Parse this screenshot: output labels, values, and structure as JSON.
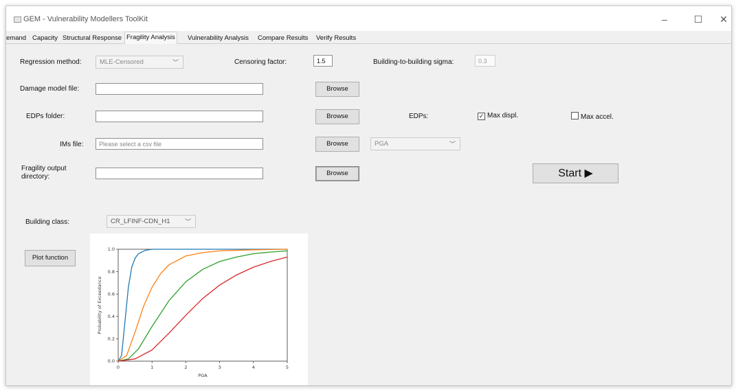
{
  "window": {
    "title": "GEM - Vulnerability Modellers ToolKit",
    "controls": {
      "minimize": "–",
      "maximize": "☐",
      "close": "✕"
    }
  },
  "tabs": [
    {
      "label": "emand",
      "active": false
    },
    {
      "label": "Capacity",
      "active": false
    },
    {
      "label": "Structural Response",
      "active": false
    },
    {
      "label": "Fragility Analysis",
      "active": true
    },
    {
      "label": "Vulnerability Analysis",
      "active": false
    },
    {
      "label": "Compare Results",
      "active": false
    },
    {
      "label": "Verify Results",
      "active": false
    }
  ],
  "form": {
    "regression_label": "Regression method:",
    "regression_value": "MLE-Censored",
    "censoring_label": "Censoring factor:",
    "censoring_value": "1.5",
    "sigma_label": "Building-to-building sigma:",
    "sigma_value": "0.3",
    "damage_model_label": "Damage model file:",
    "damage_model_value": "",
    "edps_folder_label": "EDPs folder:",
    "edps_folder_value": "",
    "edps_label": "EDPs:",
    "max_displ_label": "Max displ.",
    "max_displ_checked": true,
    "max_accel_label": "Max accel.",
    "max_accel_checked": false,
    "ims_label": "IMs file:",
    "ims_placeholder": "Please select a csv file",
    "im_type_value": "PGA",
    "output_label_line1": "Fragility output",
    "output_label_line2": "directory:",
    "output_value": "",
    "browse_label": "Browse",
    "start_label": "Start ▶",
    "building_class_label": "Building class:",
    "building_class_value": "CR_LFINF-CDN_H1",
    "plot_button_label": "Plot function"
  },
  "chart_data": {
    "type": "line",
    "xlabel": "PGA",
    "ylabel": "Probability of Exceedance",
    "xlim": [
      0,
      5
    ],
    "ylim": [
      0,
      1
    ],
    "xticks": [
      0,
      1,
      2,
      3,
      4,
      5
    ],
    "yticks": [
      0.0,
      0.2,
      0.4,
      0.6,
      0.8,
      1.0
    ],
    "xtick_labels": [
      "0",
      "1",
      "2",
      "3",
      "4",
      "5"
    ],
    "ytick_labels": [
      "0.0",
      "0.2",
      "0.4",
      "0.6",
      "0.8",
      "1.0"
    ],
    "grid": false,
    "series": [
      {
        "color": "#1f77b4",
        "x": [
          0,
          0.1,
          0.2,
          0.3,
          0.4,
          0.5,
          0.6,
          0.8,
          1.0,
          1.5,
          2,
          3,
          4,
          5
        ],
        "y": [
          0,
          0.05,
          0.35,
          0.66,
          0.84,
          0.92,
          0.96,
          0.99,
          1.0,
          1.0,
          1.0,
          1.0,
          1.0,
          1.0
        ]
      },
      {
        "color": "#ff7f0e",
        "x": [
          0,
          0.25,
          0.5,
          0.75,
          1.0,
          1.25,
          1.5,
          2.0,
          2.5,
          3.0,
          4.0,
          5.0
        ],
        "y": [
          0,
          0.05,
          0.26,
          0.49,
          0.66,
          0.78,
          0.86,
          0.94,
          0.97,
          0.985,
          0.995,
          1.0
        ]
      },
      {
        "color": "#2ca02c",
        "x": [
          0,
          0.3,
          0.6,
          1.0,
          1.5,
          2.0,
          2.5,
          3.0,
          3.5,
          4.0,
          4.5,
          5.0
        ],
        "y": [
          0,
          0.02,
          0.11,
          0.31,
          0.54,
          0.71,
          0.82,
          0.89,
          0.93,
          0.96,
          0.975,
          0.985
        ]
      },
      {
        "color": "#d62728",
        "x": [
          0,
          0.5,
          1.0,
          1.5,
          2.0,
          2.5,
          3.0,
          3.5,
          4.0,
          4.5,
          5.0
        ],
        "y": [
          0,
          0.02,
          0.1,
          0.25,
          0.41,
          0.56,
          0.68,
          0.77,
          0.84,
          0.89,
          0.93
        ]
      }
    ]
  }
}
